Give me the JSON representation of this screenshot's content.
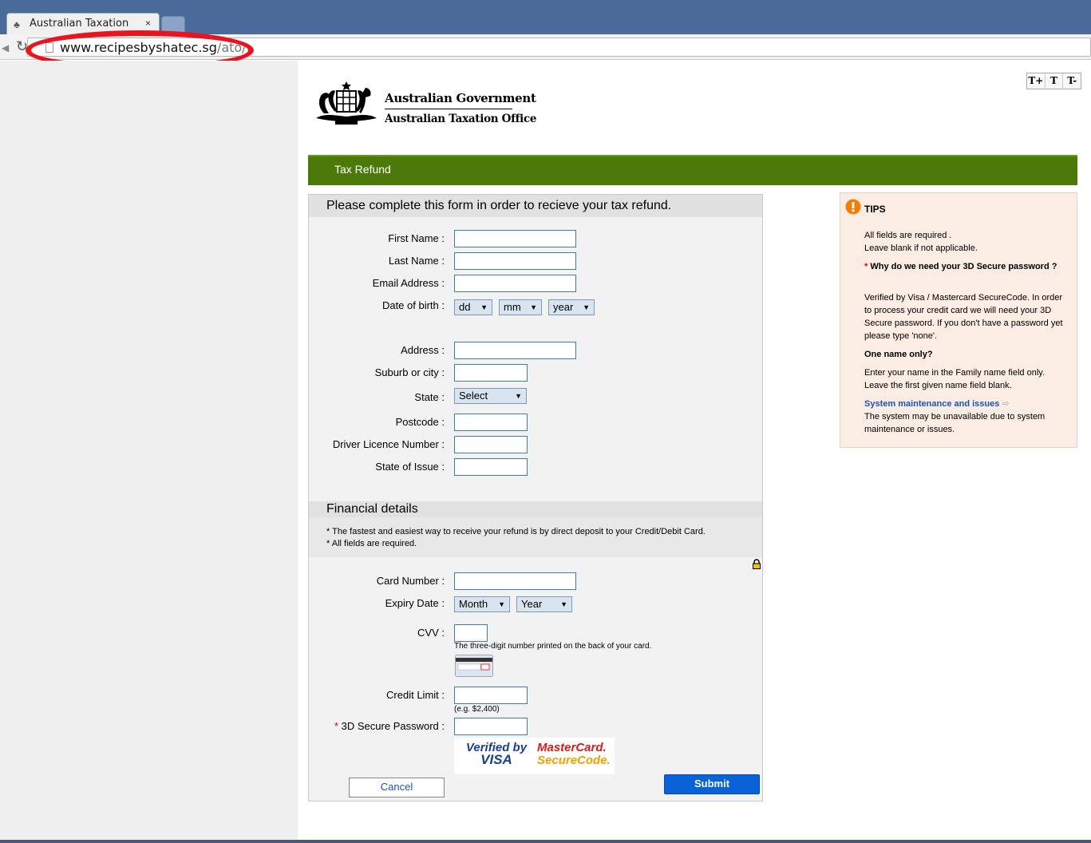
{
  "browser": {
    "tab_title": "Australian Taxation",
    "tab_close": "×",
    "url_host": "www.recipesbyshatec.sg",
    "url_path": "/ato/"
  },
  "text_size": {
    "increase": "T+",
    "normal": "T",
    "decrease": "T-"
  },
  "header": {
    "gov_name": "Australian Government",
    "agency_name": "Australian Taxation Office"
  },
  "banner": {
    "title": "Tax Refund"
  },
  "form": {
    "intro": "Please complete this form in order to recieve your tax refund.",
    "first_name_label": "First Name :",
    "last_name_label": "Last Name :",
    "email_label": "Email Address :",
    "dob_label": "Date of birth :",
    "dob_day": "dd",
    "dob_month": "mm",
    "dob_year": "year",
    "address_label": "Address :",
    "suburb_label": "Suburb or city :",
    "state_label": "State :",
    "state_value": "Select",
    "postcode_label": "Postcode :",
    "licence_label": "Driver Licence Number :",
    "issue_label": "State of Issue :"
  },
  "financial": {
    "title": "Financial details",
    "note1": "* The fastest and easiest way to receive your refund is by direct deposit to your Credit/Debit Card.",
    "note2": "* All fields are required.",
    "card_label": "Card Number :",
    "expiry_label": "Expiry Date :",
    "expiry_month": "Month",
    "expiry_year": "Year",
    "cvv_label": "CVV :",
    "cvv_help": "The three-digit number printed on the back of your card.",
    "limit_label": "Credit Limit :",
    "limit_help": "(e.g. $2,400)",
    "secure_star": "*",
    "secure_label": "3D Secure Password :",
    "visa_line1": "Verified by",
    "visa_line2": "VISA",
    "mc_line1": "MasterCard.",
    "mc_line2": "SecureCode.",
    "cancel": "Cancel",
    "submit": "Submit"
  },
  "tips": {
    "title": "TIPS",
    "req1": "All fields are required .",
    "req2": "Leave blank if not applicable.",
    "why_star": "*",
    "why_q": "Why do we need your 3D Secure password ?",
    "why_a": "Verified by Visa / Mastercard SecureCode. In order to process your credit card we will need your 3D Secure password. If you don't have a password yet please type 'none'.",
    "one_name_q": "One name only?",
    "one_name_a": "Enter your name in the Family name field only. Leave the first given name field blank.",
    "maint_link": "System maintenance and issues",
    "maint_a": "The system may be unavailable due to system maintenance or issues."
  },
  "colors": {
    "banner": "#4c7a0a",
    "submit": "#0a62d8",
    "link": "#1a55b5",
    "tips_bg": "#fbece4",
    "highlight": "#e8141e"
  }
}
